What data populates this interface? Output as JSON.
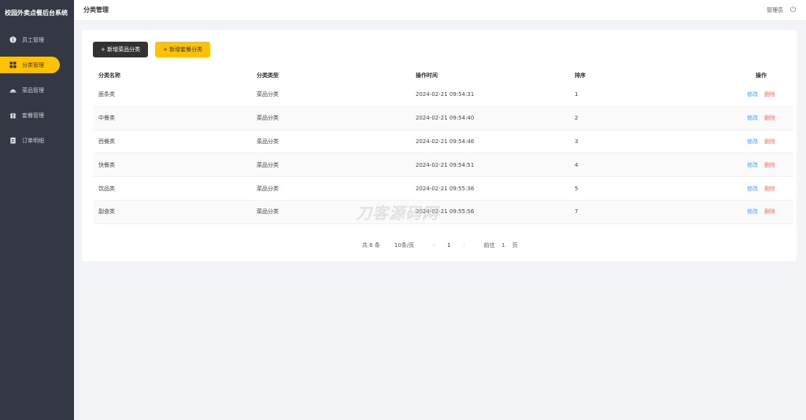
{
  "app": {
    "title": "校园外卖点餐后台系统"
  },
  "sidebar": {
    "items": [
      {
        "label": "员工管理",
        "icon": "info-circle-icon",
        "active": false
      },
      {
        "label": "分类管理",
        "icon": "grid-icon",
        "active": true
      },
      {
        "label": "菜品管理",
        "icon": "dish-icon",
        "active": false
      },
      {
        "label": "套餐管理",
        "icon": "gift-icon",
        "active": false
      },
      {
        "label": "订单明细",
        "icon": "clipboard-icon",
        "active": false
      }
    ]
  },
  "header": {
    "title": "分类管理",
    "user": "管理员",
    "power_icon": "power-icon"
  },
  "toolbar": {
    "add_dish_category": "+ 新增菜品分类",
    "add_setmeal_category": "+ 新增套餐分类"
  },
  "table": {
    "columns": [
      "分类名称",
      "分类类型",
      "操作时间",
      "排序",
      "操作"
    ],
    "rows": [
      {
        "name": "面条类",
        "type": "菜品分类",
        "time": "2024-02-21 09:54:31",
        "sort": "1",
        "edit": "修改",
        "delete": "删除"
      },
      {
        "name": "中餐类",
        "type": "菜品分类",
        "time": "2024-02-21 09:54:40",
        "sort": "2",
        "edit": "修改",
        "delete": "删除"
      },
      {
        "name": "西餐类",
        "type": "菜品分类",
        "time": "2024-02-21 09:54:46",
        "sort": "3",
        "edit": "修改",
        "delete": "删除"
      },
      {
        "name": "快餐类",
        "type": "菜品分类",
        "time": "2024-02-21 09:54:51",
        "sort": "4",
        "edit": "修改",
        "delete": "删除"
      },
      {
        "name": "饮品类",
        "type": "菜品分类",
        "time": "2024-02-21 09:55:36",
        "sort": "5",
        "edit": "修改",
        "delete": "删除"
      },
      {
        "name": "副食类",
        "type": "菜品分类",
        "time": "2024-02-21 09:55:56",
        "sort": "7",
        "edit": "修改",
        "delete": "删除"
      }
    ]
  },
  "pagination": {
    "total": "共 6 条",
    "page_size": "10条/页",
    "prev": "‹",
    "current": "1",
    "next": "›",
    "goto_prefix": "前往",
    "goto_value": "1",
    "goto_suffix": "页"
  },
  "watermark": "刀客源码网",
  "colors": {
    "sidebar_bg": "#343744",
    "accent": "#ffc200",
    "edit": "#419eff",
    "delete": "#f56c6c"
  }
}
